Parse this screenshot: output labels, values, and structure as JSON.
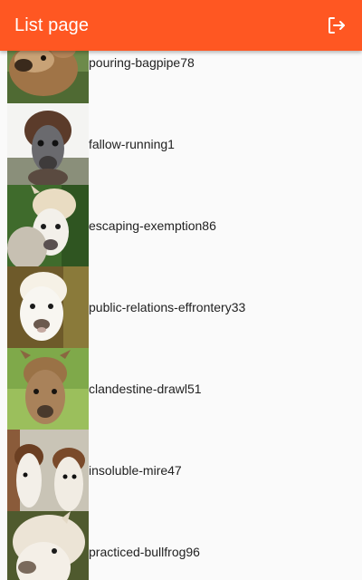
{
  "app_bar": {
    "title": "List page",
    "action_icon": "logout-icon",
    "color": "#ff5722"
  },
  "list": {
    "items": [
      {
        "label": "pouring-bagpipe78",
        "image": "alpaca-photo"
      },
      {
        "label": "fallow-running1",
        "image": "alpaca-photo"
      },
      {
        "label": "escaping-exemption86",
        "image": "alpaca-photo"
      },
      {
        "label": "public-relations-effrontery33",
        "image": "alpaca-photo"
      },
      {
        "label": "clandestine-drawl51",
        "image": "alpaca-photo"
      },
      {
        "label": "insoluble-mire47",
        "image": "alpaca-photo"
      },
      {
        "label": "practiced-bullfrog96",
        "image": "alpaca-photo"
      }
    ]
  }
}
